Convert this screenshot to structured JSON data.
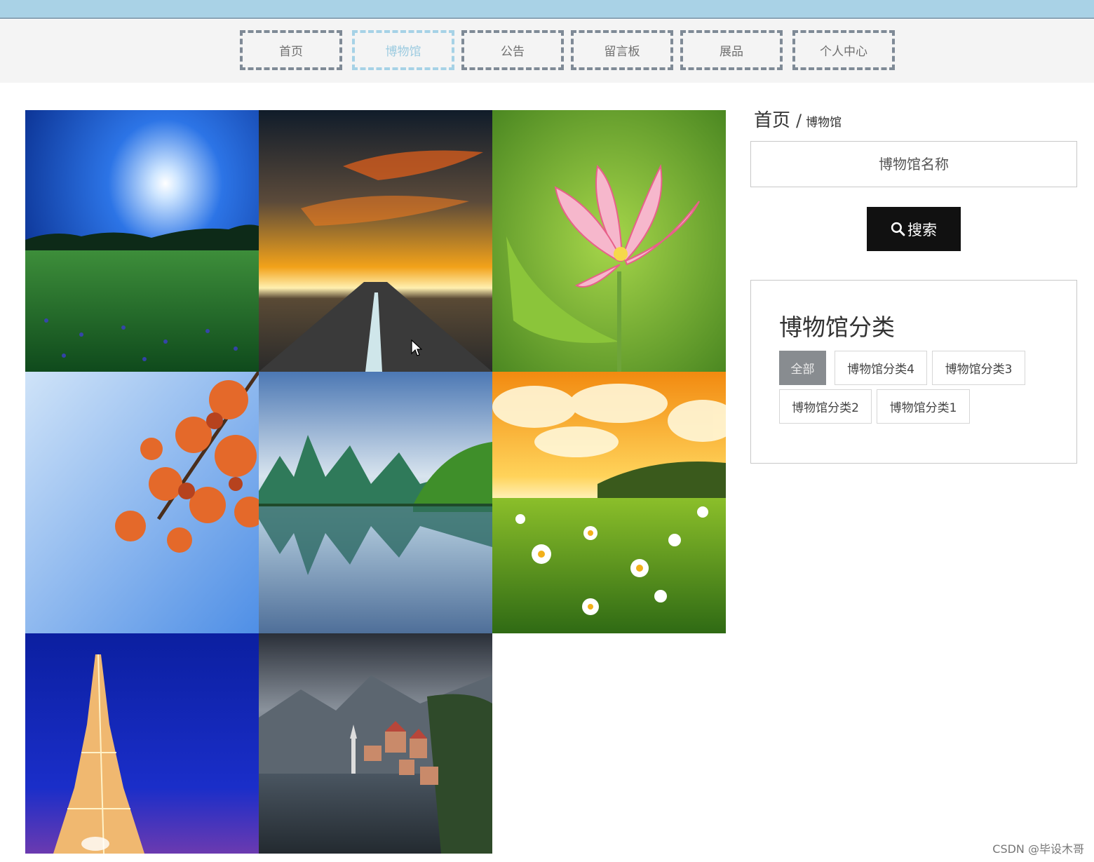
{
  "nav": {
    "items": [
      {
        "label": "首页",
        "active": false
      },
      {
        "label": "博物馆",
        "active": true
      },
      {
        "label": "公告",
        "active": false
      },
      {
        "label": "留言板",
        "active": false
      },
      {
        "label": "展品",
        "active": false
      },
      {
        "label": "个人中心",
        "active": false
      }
    ]
  },
  "breadcrumb": {
    "home": "首页",
    "separator": "/",
    "current": "博物馆"
  },
  "search": {
    "placeholder": "博物馆名称",
    "button_label": "搜索",
    "button_icon": "search-icon"
  },
  "categories": {
    "title": "博物馆分类",
    "items": [
      {
        "label": "全部",
        "active": true
      },
      {
        "label": "博物馆分类4",
        "active": false
      },
      {
        "label": "博物馆分类3",
        "active": false
      },
      {
        "label": "博物馆分类2",
        "active": false
      },
      {
        "label": "博物馆分类1",
        "active": false
      }
    ]
  },
  "gallery": {
    "images": [
      {
        "scene": "moonlit-meadow"
      },
      {
        "scene": "sunset-road"
      },
      {
        "scene": "pink-lotus"
      },
      {
        "scene": "autumn-maple"
      },
      {
        "scene": "karst-river-reflection"
      },
      {
        "scene": "daisy-field-sunset"
      },
      {
        "scene": "eiffel-tower-night"
      },
      {
        "scene": "lakeside-village"
      }
    ]
  },
  "watermark": "CSDN @毕设木哥",
  "colors": {
    "accent_active": "#a6d2e6",
    "top_strip": "#a9d2e6",
    "search_button": "#111111",
    "category_active": "#888c90"
  }
}
